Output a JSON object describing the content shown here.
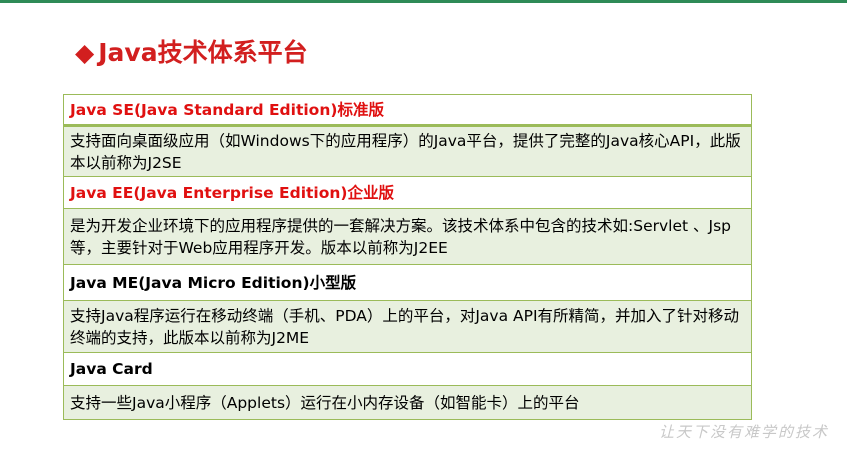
{
  "slide": {
    "bullet": "◆",
    "title": "Java技术体系平台",
    "watermark": "让天下没有难学的技术"
  },
  "table": {
    "rows": [
      {
        "kind": "head",
        "text": "Java SE(Java Standard Edition)标准版"
      },
      {
        "kind": "desc",
        "text": "支持面向桌面级应用（如Windows下的应用程序）的Java平台，提供了完整的Java核心API，此版本以前称为J2SE"
      },
      {
        "kind": "head",
        "text": "Java EE(Java Enterprise Edition)企业版"
      },
      {
        "kind": "desc",
        "text": "是为开发企业环境下的应用程序提供的一套解决方案。该技术体系中包含的技术如:Servlet 、Jsp等，主要针对于Web应用程序开发。版本以前称为J2EE"
      },
      {
        "kind": "head",
        "text": "Java ME(Java Micro Edition)小型版"
      },
      {
        "kind": "desc",
        "text": "支持Java程序运行在移动终端（手机、PDA）上的平台，对Java API有所精简，并加入了针对移动终端的支持，此版本以前称为J2ME"
      },
      {
        "kind": "head",
        "text": "Java Card"
      },
      {
        "kind": "desc",
        "text": "支持一些Java小程序（Applets）运行在小内存设备（如智能卡）上的平台"
      }
    ]
  },
  "colors": {
    "title_red": "#d21f1f",
    "heading_red": "#e01010",
    "border_green": "#9bbb59",
    "desc_fill": "#e8f0df"
  }
}
